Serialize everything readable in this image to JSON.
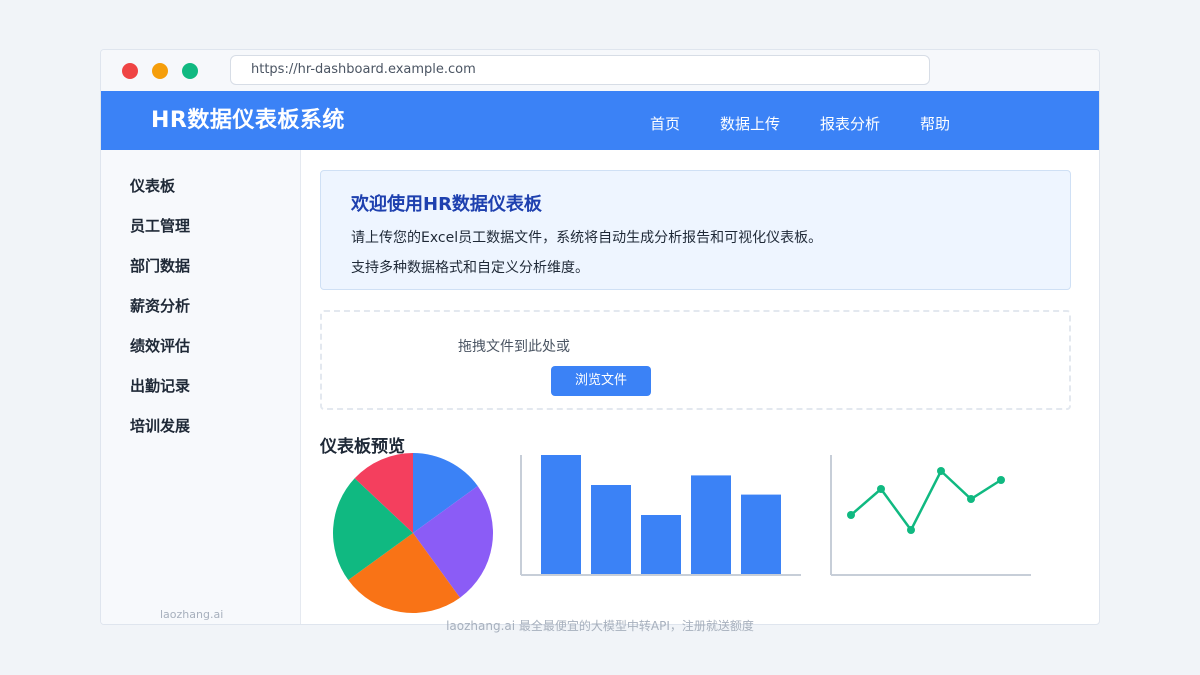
{
  "browser": {
    "url": "https://hr-dashboard.example.com"
  },
  "header": {
    "brand": "HR数据仪表板系统",
    "nav": [
      "首页",
      "数据上传",
      "报表分析",
      "帮助"
    ]
  },
  "sidebar": {
    "items": [
      "仪表板",
      "员工管理",
      "部门数据",
      "薪资分析",
      "绩效评估",
      "出勤记录",
      "培训发展"
    ],
    "footer": "laozhang.ai"
  },
  "welcome": {
    "title": "欢迎使用HR数据仪表板",
    "line1": "请上传您的Excel员工数据文件，系统将自动生成分析报告和可视化仪表板。",
    "line2": "支持多种数据格式和自定义分析维度。"
  },
  "upload": {
    "prompt": "拖拽文件到此处或",
    "button": "浏览文件"
  },
  "preview": {
    "title": "仪表板预览"
  },
  "chart_data": [
    {
      "type": "pie",
      "values": [
        15,
        25,
        25,
        22,
        13
      ],
      "colors": [
        "#3b82f6",
        "#8b5cf6",
        "#f97316",
        "#10b981",
        "#f43f5e"
      ]
    },
    {
      "type": "bar",
      "values": [
        100,
        75,
        50,
        83,
        67
      ],
      "ylim": [
        0,
        100
      ],
      "color": "#3b82f6"
    },
    {
      "type": "line",
      "values": [
        60,
        86,
        45,
        104,
        76,
        95
      ],
      "ylim": [
        0,
        120
      ],
      "color": "#10b981"
    }
  ],
  "footer": {
    "watermark": "laozhang.ai 最全最便宜的大模型中转API，注册就送额度"
  },
  "colors": {
    "accent": "#3b82f6",
    "window_red": "#ef4444",
    "window_yellow": "#f59e0b",
    "window_green": "#10b981"
  }
}
